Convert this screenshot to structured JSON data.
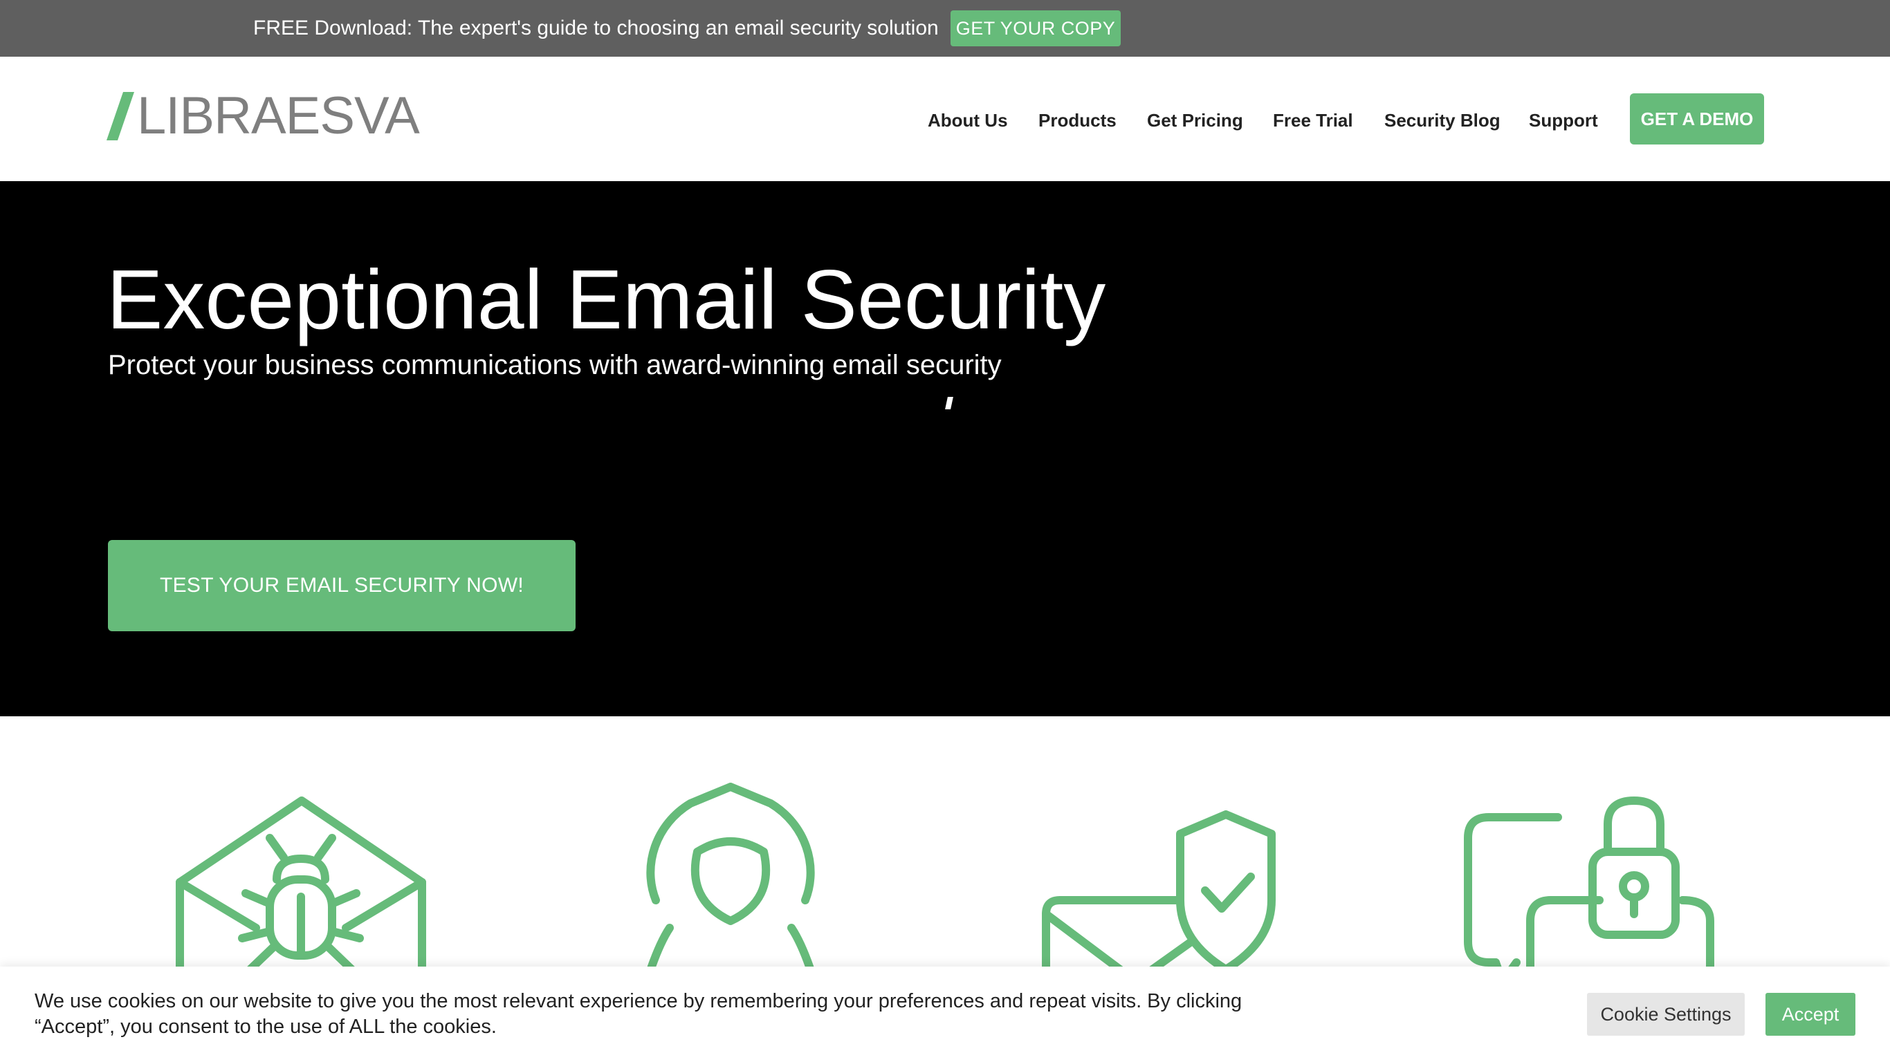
{
  "topbar": {
    "text": "FREE Download: The expert's guide to choosing an email security solution",
    "button_label": "GET YOUR COPY"
  },
  "header": {
    "logo_text": "LIBRAESVA",
    "nav": [
      {
        "label": "About Us"
      },
      {
        "label": "Products"
      },
      {
        "label": "Get Pricing"
      },
      {
        "label": "Free Trial"
      },
      {
        "label": "Security Blog"
      },
      {
        "label": "Support"
      }
    ],
    "demo_label": "GET A DEMO"
  },
  "hero": {
    "title": "Exceptional Email Security",
    "subtitle": "Protect your business communications with award-winning email security",
    "cta_label": "TEST YOUR EMAIL SECURITY NOW!"
  },
  "features": {
    "icons": [
      "email-bug-icon",
      "hooded-hacker-icon",
      "email-shield-check-icon",
      "chat-padlock-icon"
    ]
  },
  "cookie": {
    "text": "We use cookies on our website to give you the most relevant experience by remembering your preferences and repeat visits. By clicking “Accept”, you consent to the use of ALL the cookies.",
    "settings_label": "Cookie Settings",
    "accept_label": "Accept"
  },
  "colors": {
    "accent": "#66bb7a",
    "topbar": "#5f5f5f",
    "hero": "#000000",
    "logo_gray": "#7f7f7f"
  }
}
